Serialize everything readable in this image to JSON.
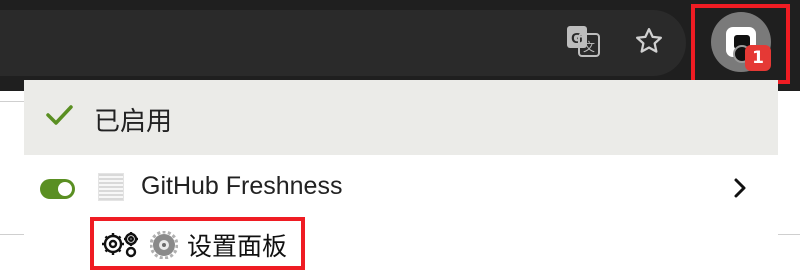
{
  "toolbar": {
    "translate_icon": "translate-icon",
    "bookmark_icon": "star-icon",
    "extension_icon": "extension-icon",
    "badge_count": "1"
  },
  "popup": {
    "header_label": "已启用",
    "extension": {
      "name": "GitHub Freshness",
      "enabled": true
    },
    "settings_label": "设置面板"
  },
  "colors": {
    "highlight": "#ef1c23",
    "toggle_on": "#5a8f22",
    "badge": "#e53935",
    "check": "#5a8f22"
  }
}
